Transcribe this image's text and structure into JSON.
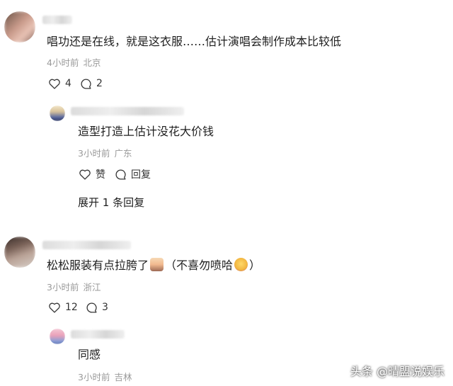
{
  "comments": [
    {
      "text": "唱功还是在线，就是这衣服……估计演唱会制作成本比较低",
      "time": "4小时前",
      "location": "北京",
      "likes": "4",
      "replies_count": "2",
      "replies": [
        {
          "text": "造型打造上估计没花大价钱",
          "time": "3小时前",
          "location": "广东",
          "like_label": "赞",
          "reply_label": "回复"
        }
      ],
      "expand_label": "展开 1 条回复"
    },
    {
      "text_main": "松松服装有点拉胯了",
      "text_paren_open": "（不喜勿喷哈",
      "text_paren_close": "）",
      "time": "3小时前",
      "location": "浙江",
      "likes": "12",
      "replies_count": "3",
      "replies": [
        {
          "text": "同感",
          "time": "3小时前",
          "location": "吉林"
        }
      ]
    }
  ],
  "watermark": "头条 @晴盟说娱乐",
  "icons": {
    "like": "heart-icon",
    "comment": "speech-bubble-icon"
  }
}
